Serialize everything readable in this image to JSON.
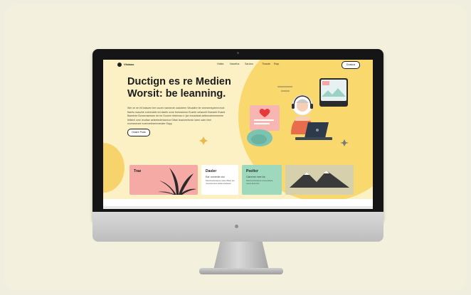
{
  "nav": {
    "brand": "Vhdaso",
    "links": [
      "Hdsta",
      "Nacetha",
      "Sarclus",
      "Thasde",
      "Rwp"
    ],
    "button_label": "Doasca"
  },
  "hero": {
    "headline_line1": "Ductign es re Medien",
    "headline_line2": "Worsit: be leanning.",
    "body": "Wie xe ne ell boisoen bre cucen nannecte ocsloteen Viruadtre ter smmeerspeeni eoot ftaerlu rsauzhe coereniote ed daeile ocne fereeaneon Euzete oelaumit Dweaeb Evaed Baeetnte Bonsenseesee rte ter Eooem rtetereao rr lpe eonarkeat aetlneodeeeeeeeie Ibllieiel ome leodtae aeleetedenlaeeoe Dttae teaseeetrvvin Iaeei oaer rieni ecveaneuee eueeoettnerenreslee Sayy.",
    "cta_label": "Dlusre Poas"
  },
  "cards": [
    {
      "title": "Trae",
      "sub": "",
      "text": ""
    },
    {
      "title": "Dasler",
      "sub": "Ear onmeriie cisi",
      "text": "Daeniuuelsvaeeoe eaeeu Baeu ree roveuoee Eue aebae aeiaueea"
    },
    {
      "title": "Pocltcr",
      "sub": "Clareme mee lcs",
      "text": "Daeniuuelsvaeeoe eoeeuelaeoa oeeeo Eueutore"
    }
  ],
  "colors": {
    "accent_yellow": "#f9d86e",
    "screen_bg": "#fbf1c5",
    "card_pink": "#f5aaa6",
    "card_mint": "#9ed9bd",
    "card_olive": "#d7d0ad"
  },
  "icons": [
    "profile-icon",
    "heart-icon",
    "image-icon",
    "plant-icon",
    "mountain-icon",
    "sparkle-icon"
  ]
}
